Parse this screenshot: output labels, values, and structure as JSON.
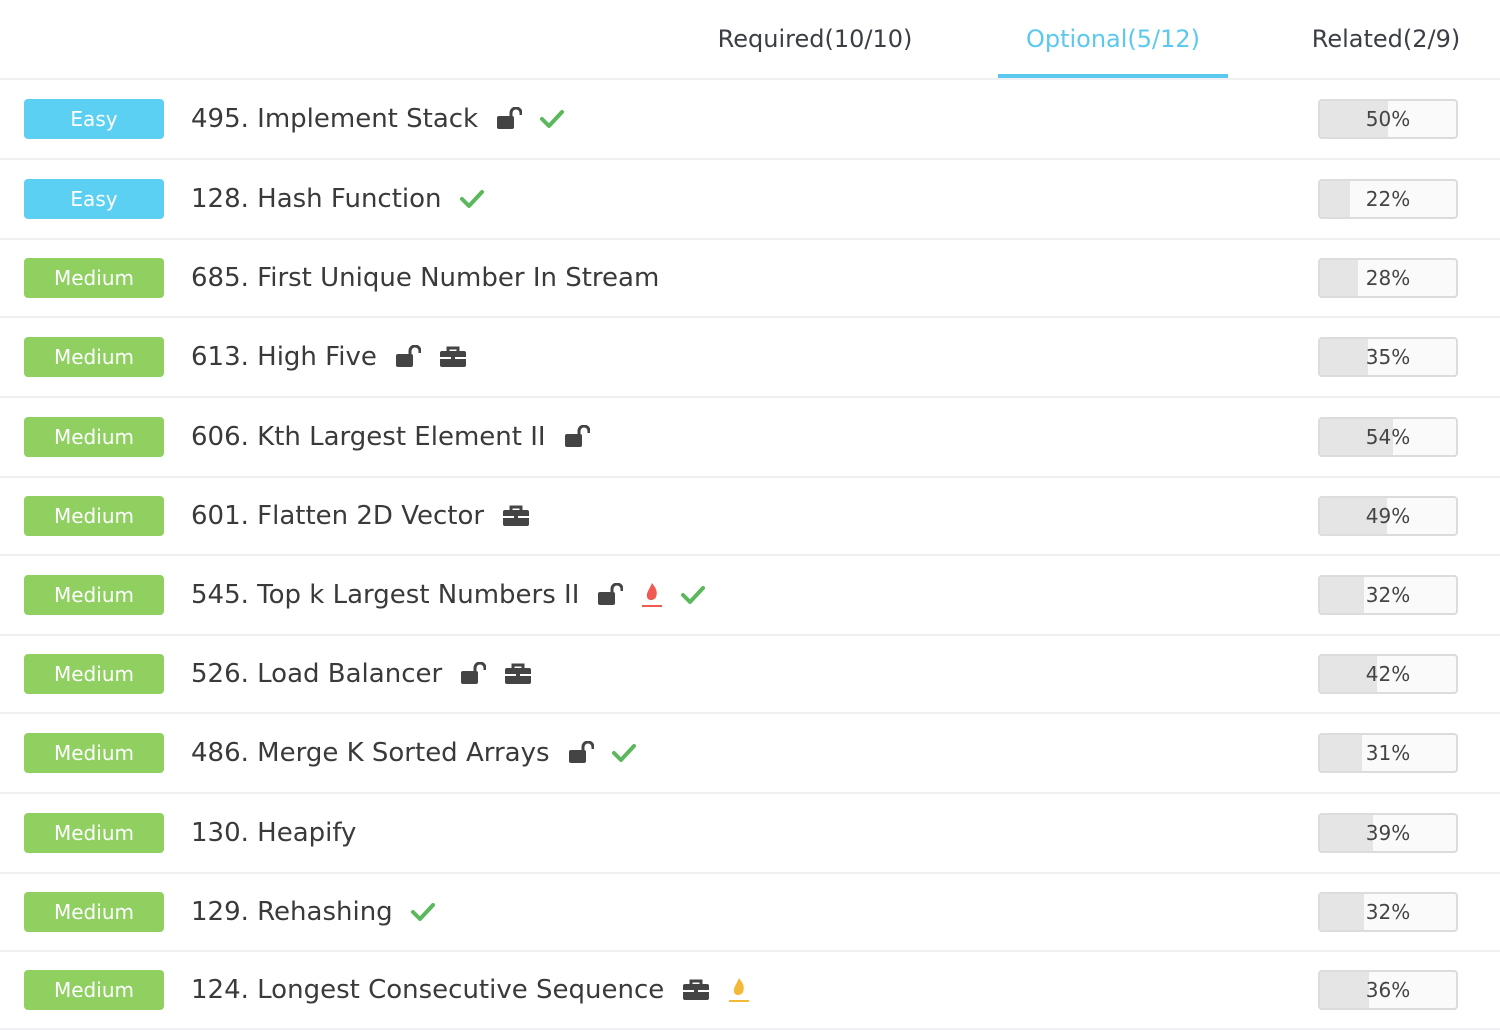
{
  "tabs": [
    {
      "label": "Required(10/10)",
      "active": false
    },
    {
      "label": "Optional(5/12)",
      "active": true
    },
    {
      "label": "Related(2/9)",
      "active": false
    }
  ],
  "colors": {
    "accent": "#5bc9ef",
    "easy": "#5bd0f3",
    "medium": "#8fd061",
    "check": "#5cb85c",
    "fire_hot": "#f05a50",
    "fire_warm": "#f5b93a"
  },
  "problems": [
    {
      "difficulty": "Easy",
      "title": "495. Implement Stack",
      "icons": [
        "unlock-icon",
        "check-icon"
      ],
      "rate": "50%",
      "rate_value": 0.5
    },
    {
      "difficulty": "Easy",
      "title": "128. Hash Function",
      "icons": [
        "check-icon"
      ],
      "rate": "22%",
      "rate_value": 0.22
    },
    {
      "difficulty": "Medium",
      "title": "685. First Unique Number In Stream",
      "icons": [],
      "rate": "28%",
      "rate_value": 0.28
    },
    {
      "difficulty": "Medium",
      "title": "613. High Five",
      "icons": [
        "unlock-icon",
        "briefcase-icon"
      ],
      "rate": "35%",
      "rate_value": 0.35
    },
    {
      "difficulty": "Medium",
      "title": "606. Kth Largest Element II",
      "icons": [
        "unlock-icon"
      ],
      "rate": "54%",
      "rate_value": 0.54
    },
    {
      "difficulty": "Medium",
      "title": "601. Flatten 2D Vector",
      "icons": [
        "briefcase-icon"
      ],
      "rate": "49%",
      "rate_value": 0.49
    },
    {
      "difficulty": "Medium",
      "title": "545. Top k Largest Numbers II",
      "icons": [
        "unlock-icon",
        "fire-hot-icon",
        "check-icon"
      ],
      "rate": "32%",
      "rate_value": 0.32
    },
    {
      "difficulty": "Medium",
      "title": "526. Load Balancer",
      "icons": [
        "unlock-icon",
        "briefcase-icon"
      ],
      "rate": "42%",
      "rate_value": 0.42
    },
    {
      "difficulty": "Medium",
      "title": "486. Merge K Sorted Arrays",
      "icons": [
        "unlock-icon",
        "check-icon"
      ],
      "rate": "31%",
      "rate_value": 0.31
    },
    {
      "difficulty": "Medium",
      "title": "130. Heapify",
      "icons": [],
      "rate": "39%",
      "rate_value": 0.39
    },
    {
      "difficulty": "Medium",
      "title": "129. Rehashing",
      "icons": [
        "check-icon"
      ],
      "rate": "32%",
      "rate_value": 0.32
    },
    {
      "difficulty": "Medium",
      "title": "124. Longest Consecutive Sequence",
      "icons": [
        "briefcase-icon",
        "fire-warm-icon"
      ],
      "rate": "36%",
      "rate_value": 0.36
    }
  ]
}
